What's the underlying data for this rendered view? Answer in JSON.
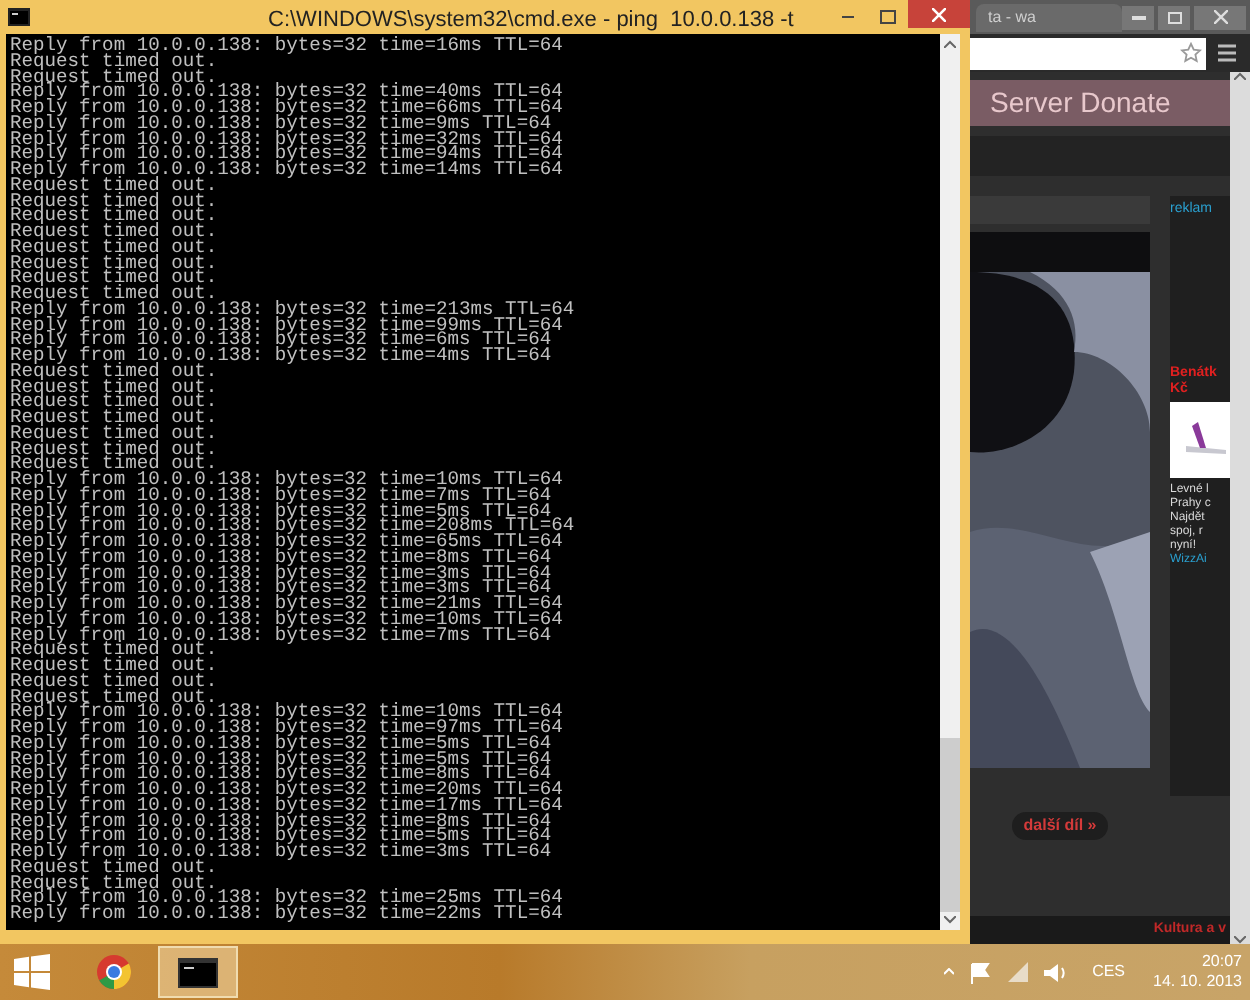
{
  "cmd_window": {
    "title": "C:\\WINDOWS\\system32\\cmd.exe - ping  10.0.0.138 -t",
    "lines": [
      "Reply from 10.0.0.138: bytes=32 time=16ms TTL=64",
      "Request timed out.",
      "Request timed out.",
      "Reply from 10.0.0.138: bytes=32 time=40ms TTL=64",
      "Reply from 10.0.0.138: bytes=32 time=66ms TTL=64",
      "Reply from 10.0.0.138: bytes=32 time=9ms TTL=64",
      "Reply from 10.0.0.138: bytes=32 time=32ms TTL=64",
      "Reply from 10.0.0.138: bytes=32 time=94ms TTL=64",
      "Reply from 10.0.0.138: bytes=32 time=14ms TTL=64",
      "Request timed out.",
      "Request timed out.",
      "Request timed out.",
      "Request timed out.",
      "Request timed out.",
      "Request timed out.",
      "Request timed out.",
      "Request timed out.",
      "Reply from 10.0.0.138: bytes=32 time=213ms TTL=64",
      "Reply from 10.0.0.138: bytes=32 time=99ms TTL=64",
      "Reply from 10.0.0.138: bytes=32 time=6ms TTL=64",
      "Reply from 10.0.0.138: bytes=32 time=4ms TTL=64",
      "Request timed out.",
      "Request timed out.",
      "Request timed out.",
      "Request timed out.",
      "Request timed out.",
      "Request timed out.",
      "Request timed out.",
      "Reply from 10.0.0.138: bytes=32 time=10ms TTL=64",
      "Reply from 10.0.0.138: bytes=32 time=7ms TTL=64",
      "Reply from 10.0.0.138: bytes=32 time=5ms TTL=64",
      "Reply from 10.0.0.138: bytes=32 time=208ms TTL=64",
      "Reply from 10.0.0.138: bytes=32 time=65ms TTL=64",
      "Reply from 10.0.0.138: bytes=32 time=8ms TTL=64",
      "Reply from 10.0.0.138: bytes=32 time=3ms TTL=64",
      "Reply from 10.0.0.138: bytes=32 time=3ms TTL=64",
      "Reply from 10.0.0.138: bytes=32 time=21ms TTL=64",
      "Reply from 10.0.0.138: bytes=32 time=10ms TTL=64",
      "Reply from 10.0.0.138: bytes=32 time=7ms TTL=64",
      "Request timed out.",
      "Request timed out.",
      "Request timed out.",
      "Request timed out.",
      "Reply from 10.0.0.138: bytes=32 time=10ms TTL=64",
      "Reply from 10.0.0.138: bytes=32 time=97ms TTL=64",
      "Reply from 10.0.0.138: bytes=32 time=5ms TTL=64",
      "Reply from 10.0.0.138: bytes=32 time=5ms TTL=64",
      "Reply from 10.0.0.138: bytes=32 time=8ms TTL=64",
      "Reply from 10.0.0.138: bytes=32 time=20ms TTL=64",
      "Reply from 10.0.0.138: bytes=32 time=17ms TTL=64",
      "Reply from 10.0.0.138: bytes=32 time=8ms TTL=64",
      "Reply from 10.0.0.138: bytes=32 time=5ms TTL=64",
      "Reply from 10.0.0.138: bytes=32 time=3ms TTL=64",
      "Request timed out.",
      "Request timed out.",
      "Reply from 10.0.0.138: bytes=32 time=25ms TTL=64",
      "Reply from 10.0.0.138: bytes=32 time=22ms TTL=64"
    ]
  },
  "browser_window": {
    "tab_title": "ta - wa",
    "banner": "Server Donate",
    "sidebar_heading": "reklam",
    "ad_title": "Benátk",
    "ad_price": "Kč",
    "ad_text": "Levné l\nPrahy c\nNajdět\nspoj, r\nnyní!",
    "ad_link": "WizzAi",
    "next_button": "další díl »",
    "footer_link": "Kultura a v"
  },
  "taskbar": {
    "apps": [
      {
        "kind": "chrome",
        "selected": false
      },
      {
        "kind": "console",
        "selected": true
      }
    ],
    "language": "CES",
    "time": "20:07",
    "date": "14. 10. 2013"
  }
}
